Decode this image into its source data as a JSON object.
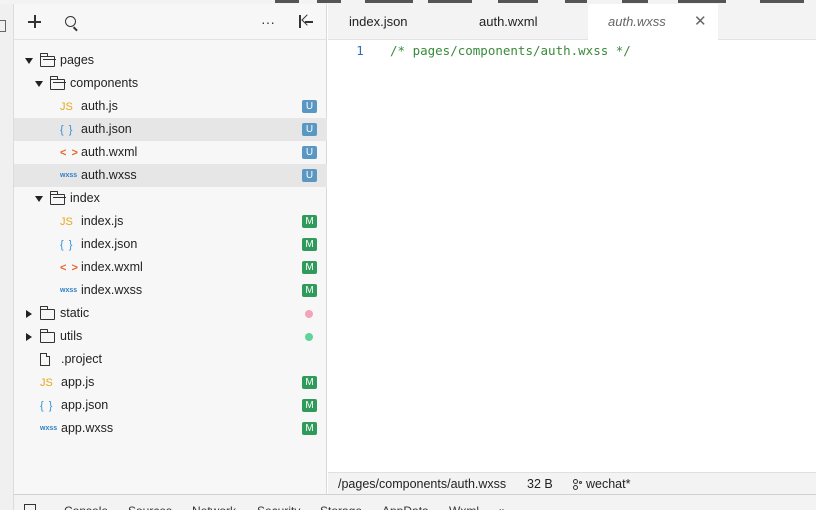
{
  "explorer": {
    "more_label": "···",
    "tree": [
      {
        "label": "pages",
        "kind": "folder",
        "open": true,
        "depth": 0
      },
      {
        "label": "components",
        "kind": "folder",
        "open": true,
        "depth": 1
      },
      {
        "label": "auth.js",
        "kind": "js",
        "depth": 2,
        "badge": "U"
      },
      {
        "label": "auth.json",
        "kind": "json",
        "depth": 2,
        "badge": "U",
        "selected": true
      },
      {
        "label": "auth.wxml",
        "kind": "wxml",
        "depth": 2,
        "badge": "U"
      },
      {
        "label": "auth.wxss",
        "kind": "wxss",
        "depth": 2,
        "badge": "U",
        "selected": true
      },
      {
        "label": "index",
        "kind": "folder",
        "open": true,
        "depth": 1
      },
      {
        "label": "index.js",
        "kind": "js",
        "depth": 2,
        "badge": "M"
      },
      {
        "label": "index.json",
        "kind": "json",
        "depth": 2,
        "badge": "M"
      },
      {
        "label": "index.wxml",
        "kind": "wxml",
        "depth": 2,
        "badge": "M"
      },
      {
        "label": "index.wxss",
        "kind": "wxss",
        "depth": 2,
        "badge": "M"
      },
      {
        "label": "static",
        "kind": "folder",
        "open": false,
        "depth": 0,
        "dot": "#f4a3b8"
      },
      {
        "label": "utils",
        "kind": "folder",
        "open": false,
        "depth": 0,
        "dot": "#5fd39a"
      },
      {
        "label": ".project",
        "kind": "file",
        "depth": 0
      },
      {
        "label": "app.js",
        "kind": "js",
        "depth": 0,
        "badge": "M"
      },
      {
        "label": "app.json",
        "kind": "json",
        "depth": 0,
        "badge": "M"
      },
      {
        "label": "app.wxss",
        "kind": "wxss",
        "depth": 0,
        "badge": "M"
      }
    ]
  },
  "icons": {
    "js": "JS",
    "json": "{ }",
    "wxml": "< >",
    "wxss": "wxss"
  },
  "editor": {
    "tabs": [
      {
        "label": "index.json"
      },
      {
        "label": "auth.wxml"
      },
      {
        "label": "auth.wxss",
        "active": true
      }
    ],
    "close_glyph": "✕",
    "lines": [
      {
        "number": "1",
        "text": "/* pages/components/auth.wxss */"
      }
    ]
  },
  "statusbar": {
    "path": "/pages/components/auth.wxss",
    "size": "32 B",
    "branch": "wechat*"
  },
  "bottom_tabs": [
    "Console",
    "Sources",
    "Network",
    "Security",
    "Storage",
    "AppData",
    "Wxml",
    "»"
  ],
  "colors": {
    "badge_u": "#5b97c3",
    "badge_m": "#2f9a5a",
    "comment": "#3a8a3a",
    "line_number": "#2f6fb5"
  }
}
